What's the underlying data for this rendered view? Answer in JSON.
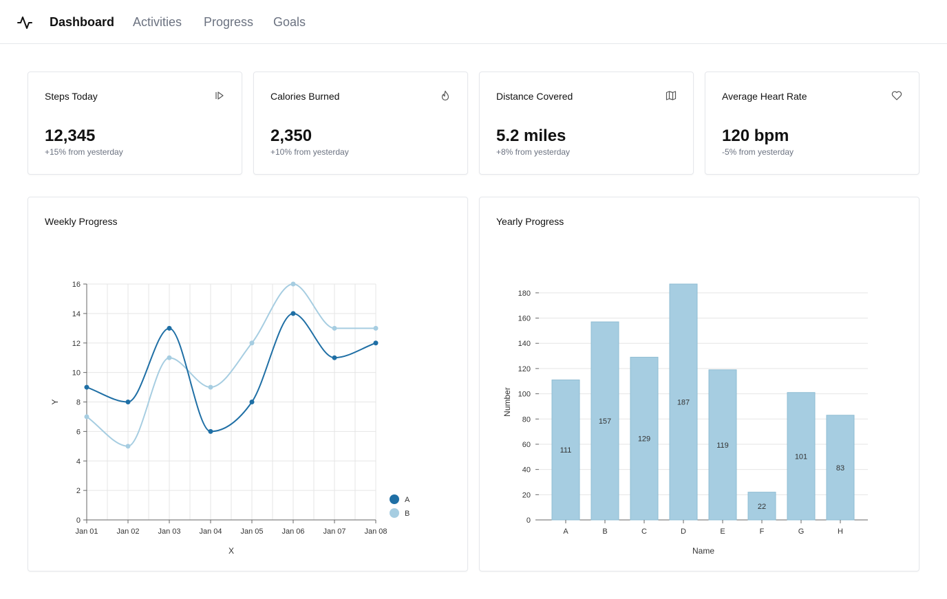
{
  "nav": {
    "logo_icon": "activity-pulse-icon",
    "links": [
      {
        "label": "Dashboard",
        "active": true
      },
      {
        "label": "Activities",
        "active": false
      },
      {
        "label": "Progress",
        "active": false
      },
      {
        "label": "Goals",
        "active": false
      }
    ]
  },
  "stats": [
    {
      "title": "Steps Today",
      "icon": "footsteps-icon",
      "value": "12,345",
      "change": "+15% from yesterday"
    },
    {
      "title": "Calories Burned",
      "icon": "flame-icon",
      "value": "2,350",
      "change": "+10% from yesterday"
    },
    {
      "title": "Distance Covered",
      "icon": "map-icon",
      "value": "5.2 miles",
      "change": "+8% from yesterday"
    },
    {
      "title": "Average Heart Rate",
      "icon": "heart-icon",
      "value": "120 bpm",
      "change": "-5% from yesterday"
    }
  ],
  "weekly": {
    "title": "Weekly Progress"
  },
  "yearly": {
    "title": "Yearly Progress"
  },
  "colors": {
    "series_a": "#1f6fa5",
    "series_b": "#a6cde1",
    "bar": "#a6cde1",
    "grid": "#e5e5e5"
  },
  "chart_data": [
    {
      "type": "line",
      "xlabel": "X",
      "ylabel": "Y",
      "categories": [
        "Jan 01",
        "Jan 02",
        "Jan 03",
        "Jan 04",
        "Jan 05",
        "Jan 06",
        "Jan 07",
        "Jan 08"
      ],
      "ylim": [
        0,
        16
      ],
      "yticks": [
        0,
        2,
        4,
        6,
        8,
        10,
        12,
        14,
        16
      ],
      "grid": true,
      "legend": "bottom-right",
      "series": [
        {
          "name": "A",
          "values": [
            9,
            8,
            13,
            6,
            8,
            14,
            11,
            12
          ]
        },
        {
          "name": "B",
          "values": [
            7,
            5,
            11,
            9,
            12,
            16,
            13,
            13
          ]
        }
      ]
    },
    {
      "type": "bar",
      "xlabel": "Name",
      "ylabel": "Number",
      "categories": [
        "A",
        "B",
        "C",
        "D",
        "E",
        "F",
        "G",
        "H"
      ],
      "values": [
        111,
        157,
        129,
        187,
        119,
        22,
        101,
        83
      ],
      "ylim": [
        0,
        187
      ],
      "yticks": [
        0,
        20,
        40,
        60,
        80,
        100,
        120,
        140,
        160,
        180
      ],
      "grid": true
    }
  ]
}
